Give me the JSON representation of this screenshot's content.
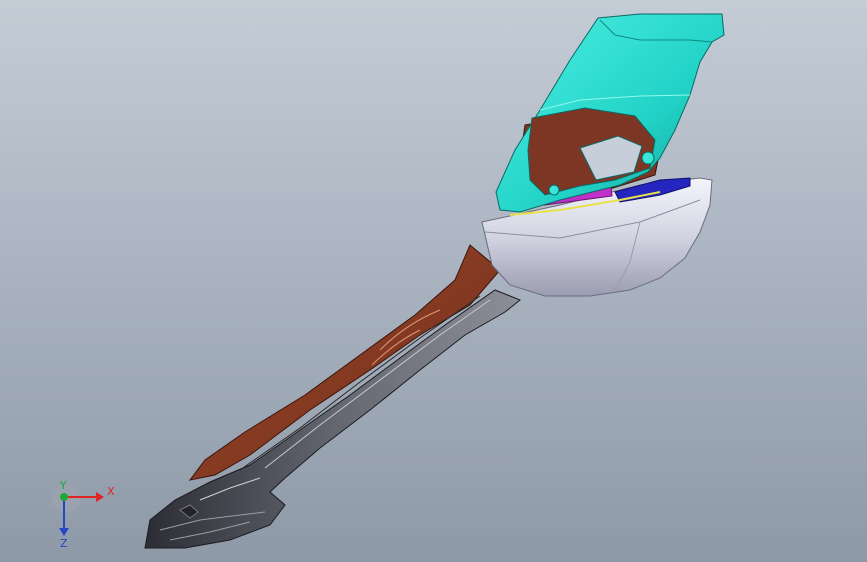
{
  "triad": {
    "x_label": "X",
    "y_label": "Y",
    "z_label": "Z",
    "colors": {
      "x": "#e02424",
      "y": "#1fa83a",
      "z": "#2346c8"
    }
  },
  "model": {
    "colors": {
      "hood": "#23d8cc",
      "bracket": "#8a3a24",
      "arm_shell": "#4a4c58",
      "head_shell": "#d8dae8",
      "clip": "#c030c8",
      "circuit": "#2020c0"
    }
  }
}
